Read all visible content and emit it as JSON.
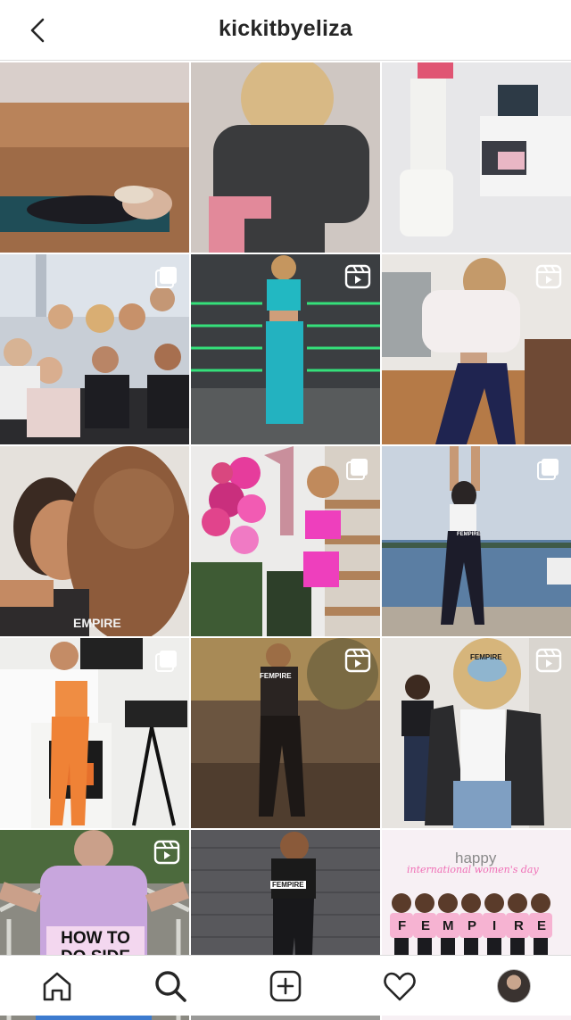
{
  "header": {
    "title": "kickitbyeliza",
    "back_icon": "chevron-left-icon"
  },
  "grid": {
    "posts": [
      {
        "type": "photo",
        "badge": ""
      },
      {
        "type": "photo",
        "badge": ""
      },
      {
        "type": "photo",
        "badge": ""
      },
      {
        "type": "carousel",
        "badge": "carousel-icon"
      },
      {
        "type": "reel",
        "badge": "reel-icon"
      },
      {
        "type": "reel",
        "badge": "reel-icon"
      },
      {
        "type": "photo",
        "badge": ""
      },
      {
        "type": "carousel",
        "badge": "carousel-icon"
      },
      {
        "type": "carousel",
        "badge": "carousel-icon"
      },
      {
        "type": "carousel",
        "badge": "carousel-icon"
      },
      {
        "type": "reel",
        "badge": "reel-icon"
      },
      {
        "type": "reel",
        "badge": "reel-icon"
      },
      {
        "type": "reel",
        "badge": "reel-icon",
        "caption": "HOW TO DO SIDE KICKS"
      },
      {
        "type": "photo",
        "badge": "",
        "shirt_text": "FEMPIRE"
      },
      {
        "type": "photo",
        "badge": "",
        "text_top": "happy",
        "text_script": "international women's day",
        "letters": [
          "F",
          "E",
          "M",
          "P",
          "I",
          "R",
          "E"
        ]
      }
    ],
    "shirt_texts": [
      "EMPIRE",
      "FEMPIRE",
      "FEMPIRE",
      "FEMPIRE",
      "FEMPIRE"
    ]
  },
  "nav": {
    "items": [
      {
        "name": "home",
        "icon": "home-icon"
      },
      {
        "name": "search",
        "icon": "search-icon",
        "active": true
      },
      {
        "name": "create",
        "icon": "plus-square-icon"
      },
      {
        "name": "activity",
        "icon": "heart-icon"
      },
      {
        "name": "profile",
        "icon": "avatar"
      }
    ]
  }
}
